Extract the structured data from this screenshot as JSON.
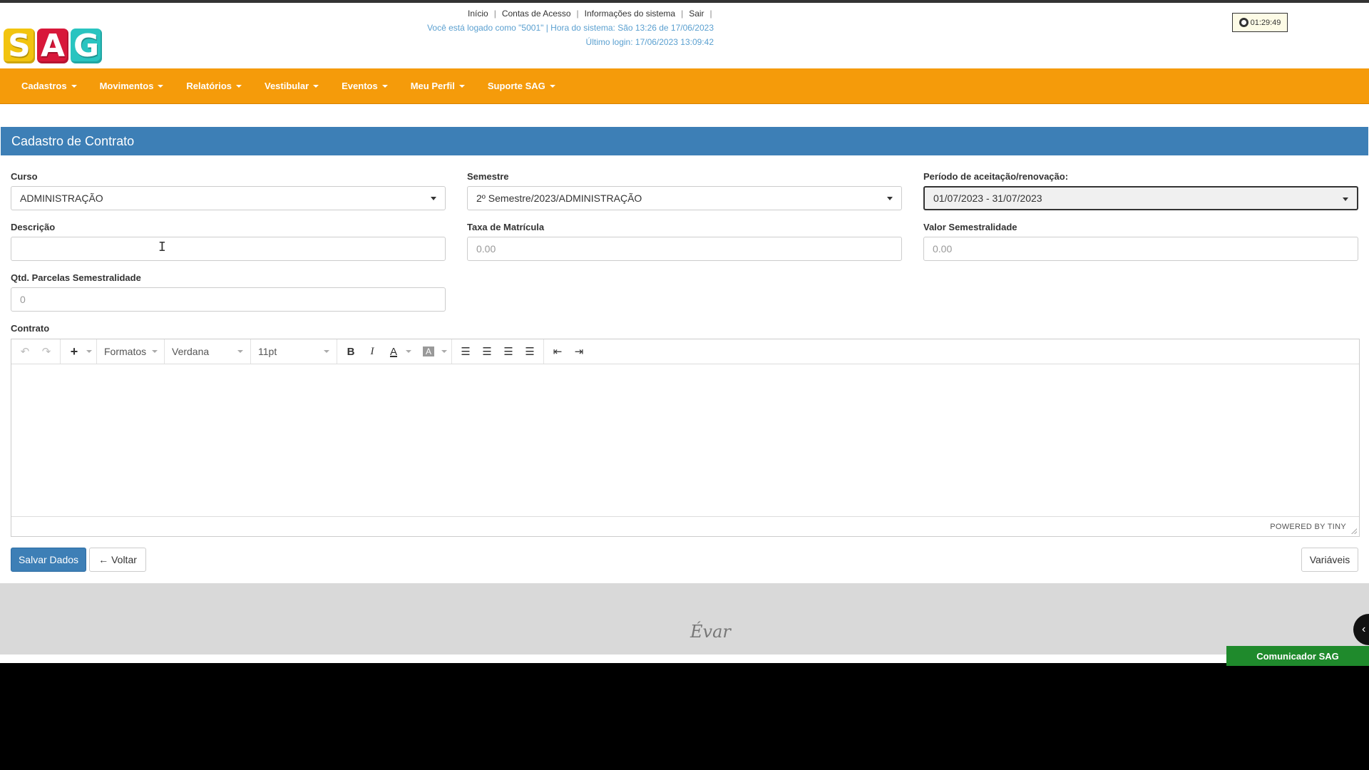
{
  "logo": {
    "letters": [
      "S",
      "A",
      "G"
    ],
    "colors": [
      "#f2c40f",
      "#d8183a",
      "#29c4c0"
    ]
  },
  "topnav": {
    "links": [
      "Início",
      "Contas de Acesso",
      "Informações do sistema",
      "Sair"
    ],
    "logged_info": "Você está logado como \"5001\" | Hora do sistema: São 13:26 de 17/06/2023",
    "last_login": "Último login: 17/06/2023 13:09:42"
  },
  "clock": {
    "icon": "clock-icon",
    "time": "01:29:49"
  },
  "mainnav": {
    "items": [
      "Cadastros",
      "Movimentos",
      "Relatórios",
      "Vestibular",
      "Eventos",
      "Meu Perfil",
      "Suporte SAG"
    ],
    "color": "#f59b0a"
  },
  "panel": {
    "title": "Cadastro de Contrato",
    "color": "#3d7fb6"
  },
  "form": {
    "curso": {
      "label": "Curso",
      "value": "ADMINISTRAÇÃO"
    },
    "semestre": {
      "label": "Semestre",
      "value": "2º Semestre/2023/ADMINISTRAÇÃO"
    },
    "periodo": {
      "label": "Período de aceitação/renovação:",
      "value": "01/07/2023 - 31/07/2023"
    },
    "descricao": {
      "label": "Descrição",
      "value": ""
    },
    "taxa": {
      "label": "Taxa de Matrícula",
      "placeholder": "0.00"
    },
    "valor": {
      "label": "Valor Semestralidade",
      "placeholder": "0.00"
    },
    "parcelas": {
      "label": "Qtd. Parcelas Semestralidade",
      "placeholder": "0"
    },
    "contrato": {
      "label": "Contrato"
    }
  },
  "editor": {
    "formats_label": "Formatos",
    "font_label": "Verdana",
    "size_label": "11pt",
    "bold": "B",
    "italic": "I",
    "text_color": "A",
    "bg_color": "A",
    "powered": "POWERED BY TINY"
  },
  "buttons": {
    "save": "Salvar Dados",
    "back": "Voltar",
    "variables": "Variáveis"
  },
  "footer": {
    "brand": "Évar"
  },
  "communicator": {
    "label": "Comunicador SAG",
    "color": "#1f8a2c"
  }
}
